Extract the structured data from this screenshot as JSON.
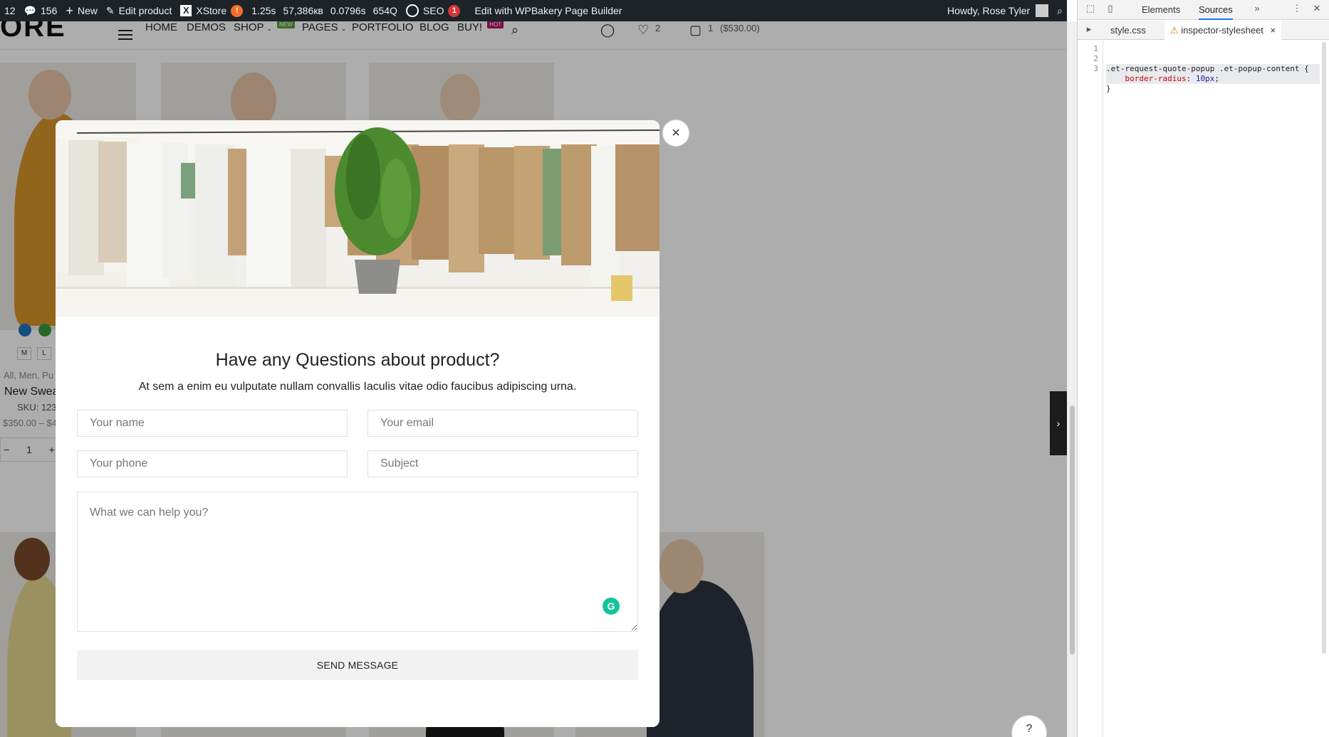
{
  "admin_bar": {
    "partial_count": "12",
    "comments_count": "156",
    "new_label": "New",
    "edit_product_label": "Edit product",
    "xstore_label": "XStore",
    "xstore_badge": "!",
    "time": "1.25s",
    "memory": "57,386кв",
    "query_time": "0.0796s",
    "queries": "654Q",
    "seo_label": "SEO",
    "seo_badge": "1",
    "wpbakery_label": "Edit with WPBakery Page Builder",
    "greeting": "Howdy, Rose Tyler"
  },
  "site_header": {
    "logo_text": "ORE",
    "nav": [
      {
        "label": "HOME"
      },
      {
        "label": "DEMOS"
      },
      {
        "label": "SHOP",
        "tag": "NEW",
        "tag_color": "#5a9e3f"
      },
      {
        "label": "PAGES"
      },
      {
        "label": "PORTFOLIO"
      },
      {
        "label": "BLOG"
      },
      {
        "label": "BUY!",
        "tag": "HOT",
        "tag_color": "#b51464"
      }
    ],
    "wishlist_count": "2",
    "cart_count": "1",
    "cart_total": "($530.00)"
  },
  "product": {
    "sizes": [
      "M",
      "L"
    ],
    "categories": "All, Men, Pu",
    "name": "New Swea",
    "sku": "SKU: 123",
    "price": "$350.00 – $4",
    "quantity": "1",
    "swatch_colors": [
      "#1e73be",
      "#3a9a3a"
    ]
  },
  "popup": {
    "title": "Have any Questions about product?",
    "description": "At sem a enim eu vulputate nullam convallis Iaculis vitae odio faucibus adipiscing urna.",
    "name_placeholder": "Your name",
    "email_placeholder": "Your email",
    "phone_placeholder": "Your phone",
    "subject_placeholder": "Subject",
    "message_placeholder": "What we can help you?",
    "send_label": "SEND MESSAGE",
    "close_glyph": "×"
  },
  "devtools": {
    "tabs": [
      "Elements",
      "Sources"
    ],
    "active_tab": "Sources",
    "files": [
      "style.css",
      "inspector-stylesheet"
    ],
    "active_file": "inspector-stylesheet",
    "code": {
      "selector": ".et-request-quote-popup .et-popup-content {",
      "property": "border-radius",
      "value": "10px",
      "close": "}"
    },
    "line_numbers": [
      "1",
      "2",
      "3"
    ]
  },
  "colors": {
    "admin_bar_bg": "#1d2327",
    "badge_orange": "#d63638",
    "accent_blue": "#1a73e8",
    "grammarly": "#15c39a"
  }
}
